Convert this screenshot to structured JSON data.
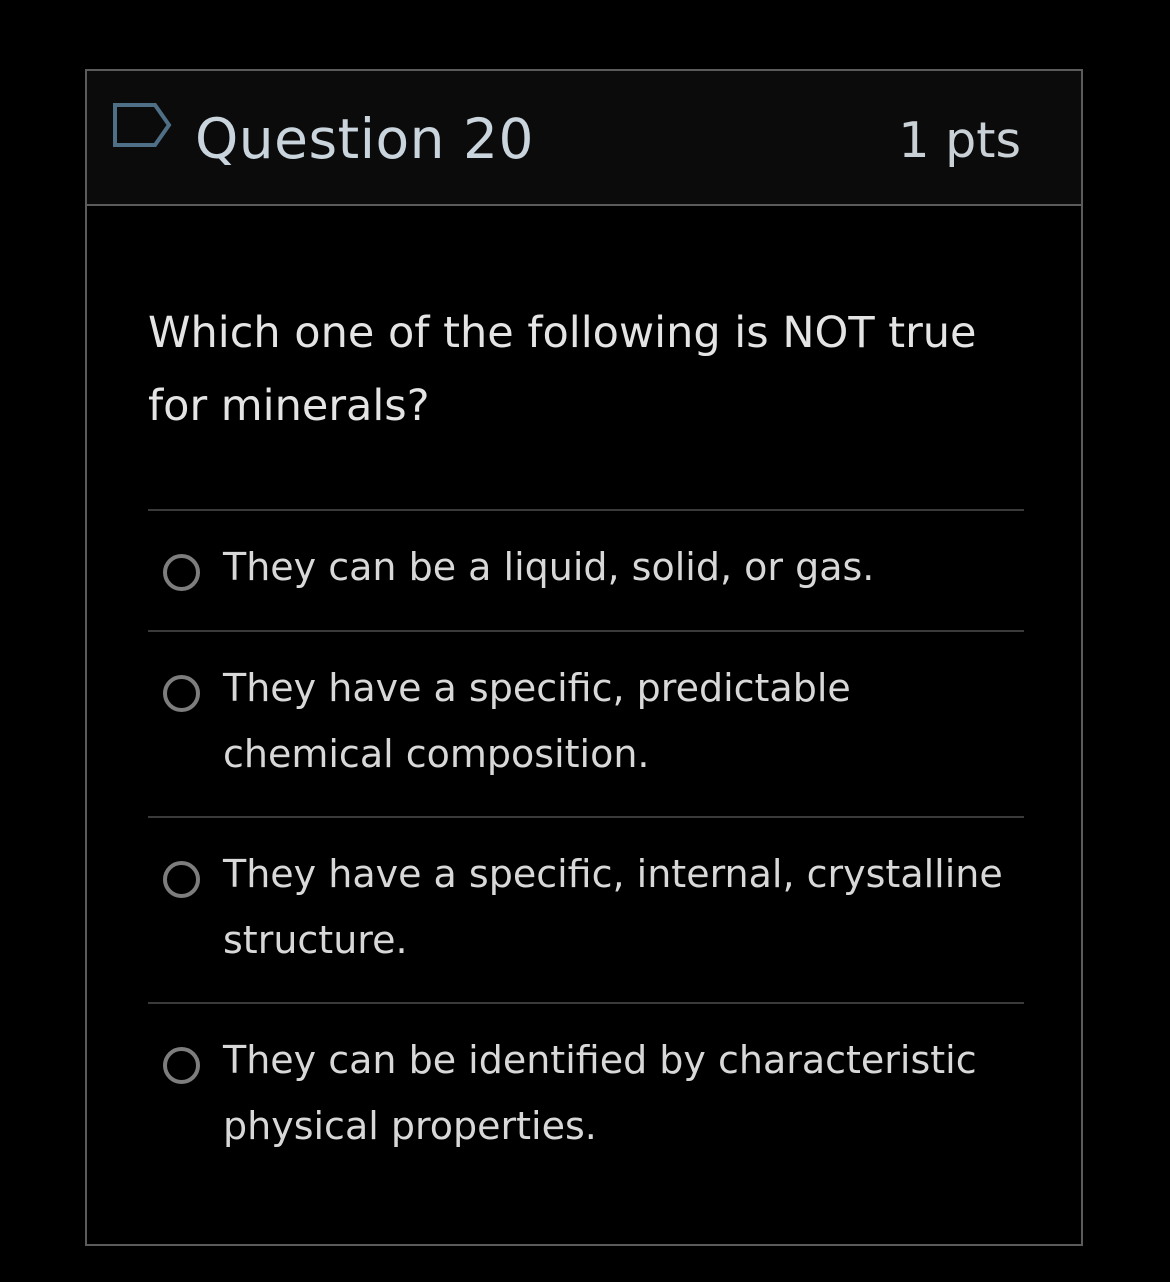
{
  "question": {
    "title": "Question 20",
    "points": "1 pts",
    "flag_icon": "flag-icon",
    "text": "Which one of the following is NOT true for minerals?"
  },
  "answers": [
    {
      "label": "They can be a liquid, solid, or gas.",
      "selected": false
    },
    {
      "label": "They have a specific, predictable chemical composition.",
      "selected": false
    },
    {
      "label": "They have a specific, internal, crystalline structure.",
      "selected": false
    },
    {
      "label": "They can be identified by characteristic physical properties.",
      "selected": false
    }
  ],
  "colors": {
    "background": "#000000",
    "border": "#5b5b5b",
    "flag_stroke": "#4f6f86",
    "title_text": "#c9d4dc",
    "radio_stroke": "#7d7d7d"
  }
}
